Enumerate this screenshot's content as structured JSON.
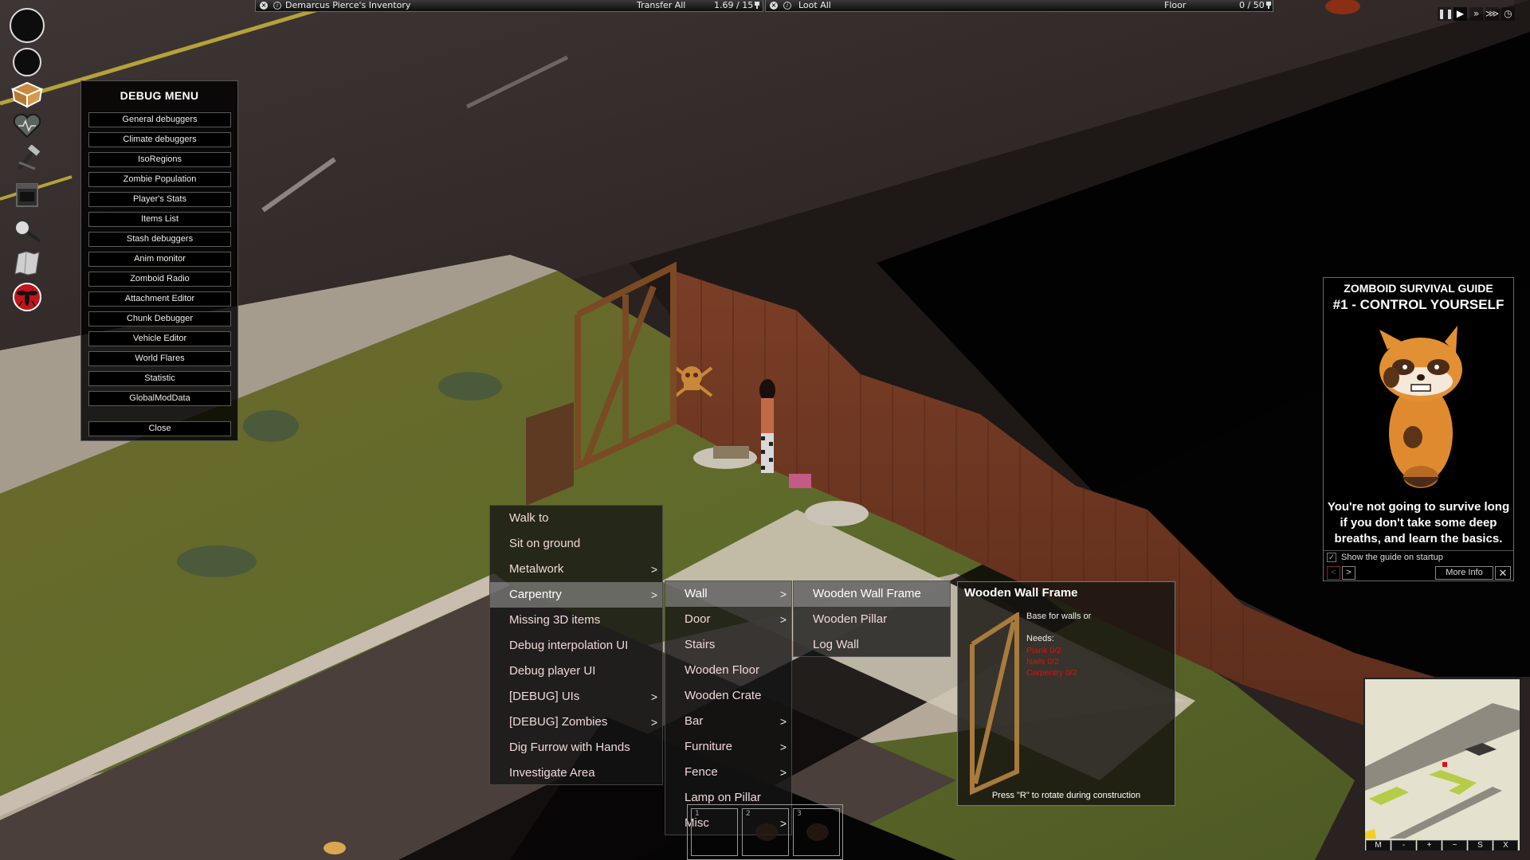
{
  "inventory_bar": {
    "title": "Demarcus Pierce's Inventory",
    "transfer_all": "Transfer All",
    "weight": "1.69 / 15"
  },
  "loot_bar": {
    "loot_all": "Loot All",
    "container": "Floor",
    "weight": "0 / 50"
  },
  "speed_controls": [
    {
      "icon": "pause-icon",
      "glyph": "❚❚"
    },
    {
      "icon": "play-icon",
      "glyph": "▶",
      "active": true
    },
    {
      "icon": "fast-forward-icon",
      "glyph": "»"
    },
    {
      "icon": "faster-forward-icon",
      "glyph": "⋙"
    },
    {
      "icon": "clock-icon",
      "glyph": "◷"
    }
  ],
  "sidebar": {
    "icons": [
      "health-status-circle",
      "moodle-circle",
      "inventory-box-icon",
      "health-heart-icon",
      "crafting-hammer-icon",
      "stove-icon",
      "search-magnifier-icon",
      "map-icon",
      "debug-mosquito-icon"
    ]
  },
  "debug_menu": {
    "title": "DEBUG MENU",
    "items": [
      "General debuggers",
      "Climate debuggers",
      "IsoRegions",
      "Zombie Population",
      "Player's Stats",
      "Items List",
      "Stash debuggers",
      "Anim monitor",
      "Zomboid Radio",
      "Attachment Editor",
      "Chunk Debugger",
      "Vehicle Editor",
      "World Flares",
      "Statistic",
      "GlobalModData"
    ],
    "close": "Close"
  },
  "context_menu": {
    "items": [
      {
        "label": "Walk to",
        "submenu": false
      },
      {
        "label": "Sit on ground",
        "submenu": false
      },
      {
        "label": "Metalwork",
        "submenu": true
      },
      {
        "label": "Carpentry",
        "submenu": true,
        "highlighted": true
      },
      {
        "label": "Missing 3D items",
        "submenu": false
      },
      {
        "label": "Debug interpolation UI",
        "submenu": false
      },
      {
        "label": "Debug player UI",
        "submenu": false
      },
      {
        "label": "[DEBUG] UIs",
        "submenu": true
      },
      {
        "label": "[DEBUG] Zombies",
        "submenu": true
      },
      {
        "label": "Dig Furrow with Hands",
        "submenu": false
      },
      {
        "label": "Investigate Area",
        "submenu": false
      }
    ],
    "arrow": ">"
  },
  "carpentry_menu": {
    "items": [
      {
        "label": "Wall",
        "submenu": true,
        "highlighted": true
      },
      {
        "label": "Door",
        "submenu": true
      },
      {
        "label": "Stairs",
        "submenu": false
      },
      {
        "label": "Wooden Floor",
        "submenu": false
      },
      {
        "label": "Wooden Crate",
        "submenu": false
      },
      {
        "label": "Bar",
        "submenu": true
      },
      {
        "label": "Furniture",
        "submenu": true
      },
      {
        "label": "Fence",
        "submenu": true
      },
      {
        "label": "Lamp on Pillar",
        "submenu": false
      },
      {
        "label": "Misc",
        "submenu": true
      }
    ]
  },
  "wall_menu": {
    "items": [
      {
        "label": "Wooden Wall Frame",
        "highlighted": true
      },
      {
        "label": "Wooden Pillar"
      },
      {
        "label": "Log Wall"
      }
    ]
  },
  "tooltip": {
    "title": "Wooden Wall Frame",
    "description": "Base for walls or",
    "needs_label": "Needs:",
    "requirements": [
      "Plank 0/2",
      "Nails 0/2",
      "Carpentry 0/2"
    ],
    "footer": "Press \"R\" to rotate during construction",
    "requirement_color": "#e01010"
  },
  "guide": {
    "title_line1": "ZOMBOID SURVIVAL GUIDE",
    "title_line2": "#1 - CONTROL YOURSELF",
    "body": "You're not going to survive long if you don't take some deep breaths, and learn the basics.",
    "show_on_startup_label": "Show the guide on startup",
    "show_on_startup_checked": true,
    "check_glyph": "✓",
    "prev": "<",
    "next": ">",
    "more_info": "More Info",
    "close": "✕"
  },
  "minimap": {
    "buttons": [
      "M",
      "-",
      "+",
      "~",
      "S",
      "X"
    ]
  },
  "hotbar": {
    "slots": [
      "1",
      "2",
      "3"
    ]
  },
  "colors": {
    "menu_text": "#f0d8d8",
    "highlight": "#a0a0a0",
    "grass": "#6b6a2c",
    "fence": "#7a3d25"
  }
}
